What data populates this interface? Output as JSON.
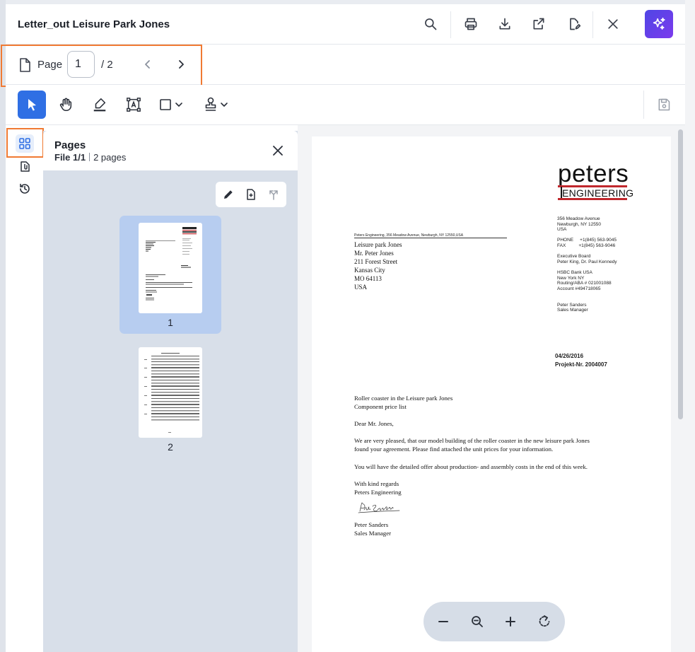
{
  "header": {
    "title": "Letter_out Leisure Park Jones",
    "buttons": [
      "search-icon",
      "print-icon",
      "download-icon",
      "share-icon",
      "edit-file-icon",
      "close-icon",
      "ai-sparkle-icon"
    ]
  },
  "pagebar": {
    "page_label": "Page",
    "current_page": "1",
    "total_pages": "/ 2"
  },
  "toolbar": {
    "tools": [
      "select-pointer-icon",
      "pan-hand-icon",
      "highlight-pen-icon",
      "text-box-icon",
      "shape-rectangle-icon",
      "stamp-icon",
      "save-icon"
    ],
    "active_tool": "select-pointer-icon"
  },
  "rail": {
    "items": [
      "thumbnails-icon",
      "attachments-icon",
      "history-icon"
    ],
    "active": "thumbnails-icon"
  },
  "panel": {
    "title": "Pages",
    "file_label": "File 1/1",
    "pages_count": "2 pages",
    "thumbnails": [
      {
        "label": "1",
        "selected": true
      },
      {
        "label": "2",
        "selected": false
      }
    ]
  },
  "letter": {
    "logo_top": "peters",
    "logo_bottom": "ENGINEERING",
    "side_info": "356 Meadow Avenue\nNewburgh, NY 12550\nUSA\n\nPHONE     +1(845) 563-9045\nFAX          +1(845) 563-9046\n\nExecutive Board\nPeter King, Dr. Paul Kennedy\n\nHSBC Bank USA\nNew York NY\nRouting/ABA # 021001088\nAccount #494718065\n\n\nPeter Sanders\nSales Manager",
    "sender_line": "Peters Engineering, 356 Meadow Avenue, Newburgh, NY 12550,USA",
    "address": [
      "Leisure park Jones",
      "Mr. Peter Jones",
      "211 Forest Street",
      "Kansas City",
      "MO 64113",
      "USA"
    ],
    "date": "04/26/2016",
    "project": "Projekt-Nr. 2004007",
    "subject_1": "Roller coaster in the Leisure park Jones",
    "subject_2": "Component price list",
    "salutation": "Dear Mr. Jones,",
    "para_1a": "We are very pleased, that our model building of the roller coaster in the new leisure park Jones",
    "para_1b": "found your agreement. Please find attached the unit prices for your information.",
    "para_2": "You will have the detailed offer about production- and assembly costs in the end of this week.",
    "closing_1": "With kind regards",
    "closing_2": "Peters Engineering",
    "signature_text": "Peter Sanders",
    "sign_name": "Peter Sanders",
    "sign_title": "Sales Manager"
  },
  "zoom": {
    "buttons": [
      "zoom-out-minus-icon",
      "zoom-fit-icon",
      "zoom-in-plus-icon",
      "rotate-icon"
    ]
  },
  "colors": {
    "accent": "#2f6fe4",
    "highlight_box": "#f07a33",
    "ai_gradient_start": "#4f46e5",
    "ai_gradient_end": "#7c3aed",
    "logo_red": "#c0282d"
  }
}
